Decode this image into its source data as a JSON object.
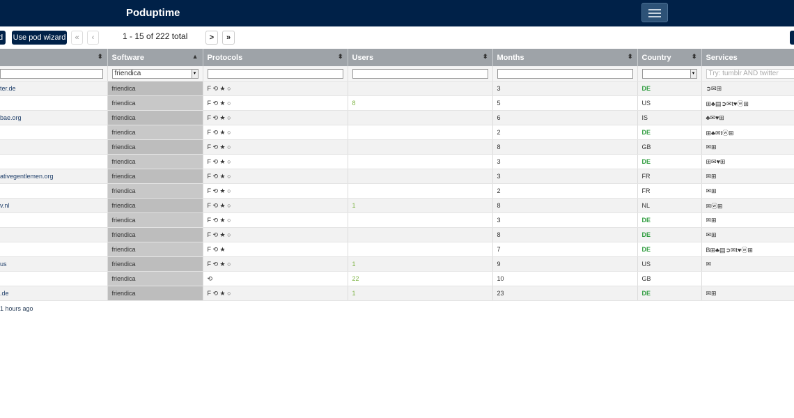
{
  "app": {
    "title": "Poduptime"
  },
  "toolbar": {
    "left_btn": "d",
    "wizard_label": "Use pod wizard",
    "first_label": "«",
    "prev_label": "‹",
    "pager_text": "1 - 15 of 222 total",
    "next_label": ">",
    "last_label": "»"
  },
  "columns": {
    "host": "",
    "software": "Software",
    "protocols": "Protocols",
    "users": "Users",
    "months": "Months",
    "country": "Country",
    "services": "Services"
  },
  "filters": {
    "software_value": "friendica",
    "services_placeholder": "Try: tumblr AND twitter"
  },
  "rows": [
    {
      "host": "ter.de",
      "software": "friendica",
      "protocols": "F ⟲ ★ ○",
      "users": "",
      "months": "3",
      "country": "DE",
      "services": "➲✉⊞"
    },
    {
      "host": "",
      "software": "friendica",
      "protocols": "F ⟲ ★ ○",
      "users": "8",
      "months": "5",
      "country": "US",
      "services": "⊞♣▤➲✉t♥ⓦ⊞"
    },
    {
      "host": "bae.org",
      "software": "friendica",
      "protocols": "F ⟲ ★ ○",
      "users": "",
      "months": "6",
      "country": "IS",
      "services": "♣✉♥⊞"
    },
    {
      "host": "",
      "software": "friendica",
      "protocols": "F ⟲ ★ ○",
      "users": "",
      "months": "2",
      "country": "DE",
      "services": "⊞♣✉tⓦ⊞"
    },
    {
      "host": "",
      "software": "friendica",
      "protocols": "F ⟲ ★ ○",
      "users": "",
      "months": "8",
      "country": "GB",
      "services": "✉⊞"
    },
    {
      "host": "",
      "software": "friendica",
      "protocols": "F ⟲ ★ ○",
      "users": "",
      "months": "3",
      "country": "DE",
      "services": "⊞✉♥⊞"
    },
    {
      "host": "ativegentlemen.org",
      "software": "friendica",
      "protocols": "F ⟲ ★ ○",
      "users": "",
      "months": "3",
      "country": "FR",
      "services": "✉⊞"
    },
    {
      "host": "",
      "software": "friendica",
      "protocols": "F ⟲ ★ ○",
      "users": "",
      "months": "2",
      "country": "FR",
      "services": "✉⊞"
    },
    {
      "host": "v.nl",
      "software": "friendica",
      "protocols": "F ⟲ ★ ○",
      "users": "1",
      "months": "8",
      "country": "NL",
      "services": "✉ⓦ⊞"
    },
    {
      "host": "",
      "software": "friendica",
      "protocols": "F ⟲ ★ ○",
      "users": "",
      "months": "3",
      "country": "DE",
      "services": "✉⊞"
    },
    {
      "host": "",
      "software": "friendica",
      "protocols": "F ⟲ ★ ○",
      "users": "",
      "months": "8",
      "country": "DE",
      "services": "✉⊞"
    },
    {
      "host": "",
      "software": "friendica",
      "protocols": "F ⟲ ★",
      "users": "",
      "months": "7",
      "country": "DE",
      "services": "B⊞♣▤➲✉t♥ⓦ⊞"
    },
    {
      "host": "us",
      "software": "friendica",
      "protocols": "F ⟲ ★ ○",
      "users": "1",
      "months": "9",
      "country": "US",
      "services": "✉"
    },
    {
      "host": "",
      "software": "friendica",
      "protocols": "⟲",
      "users": "22",
      "months": "10",
      "country": "GB",
      "services": ""
    },
    {
      "host": ".de",
      "software": "friendica",
      "protocols": "F ⟲ ★ ○",
      "users": "1",
      "months": "23",
      "country": "DE",
      "services": "✉⊞"
    }
  ],
  "footer": {
    "text": "1 hours ago"
  }
}
